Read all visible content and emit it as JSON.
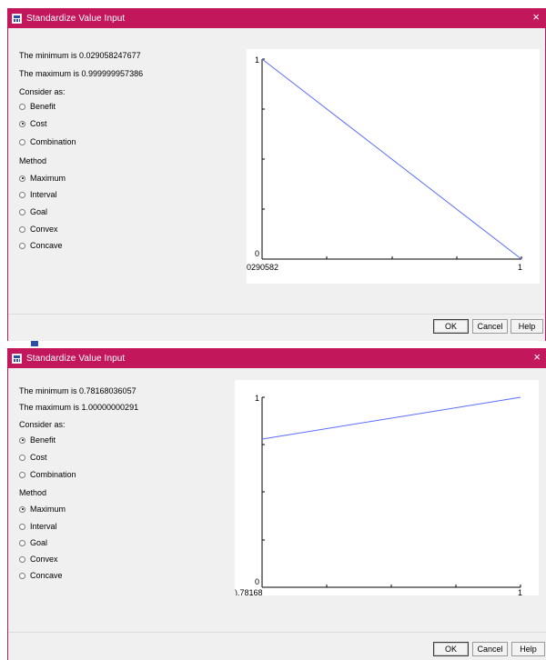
{
  "dialogs": [
    {
      "title": "Standardize Value Input",
      "close": "×",
      "min_text": "The minimum is 0.029058247677",
      "max_text": "The maximum is 0.999999957386",
      "consider_label": "Consider as:",
      "consider_options": [
        {
          "label": "Benefit",
          "selected": false
        },
        {
          "label": "Cost",
          "selected": true
        },
        {
          "label": "Combination",
          "selected": false
        }
      ],
      "method_label": "Method",
      "method_options": [
        {
          "label": "Maximum",
          "selected": true
        },
        {
          "label": "Interval",
          "selected": false
        },
        {
          "label": "Goal",
          "selected": false
        },
        {
          "label": "Convex",
          "selected": false
        },
        {
          "label": "Concave",
          "selected": false
        }
      ],
      "chart": {
        "y_top_label": "1",
        "y_bottom_label": "0",
        "x_left_label": "0290582",
        "x_right_label": "1"
      },
      "buttons": {
        "ok": "OK",
        "cancel": "Cancel",
        "help": "Help"
      }
    },
    {
      "title": "Standardize Value Input",
      "close": "×",
      "min_text": "The minimum is 0.78168036057",
      "max_text": "The maximum is 1.00000000291",
      "consider_label": "Consider as:",
      "consider_options": [
        {
          "label": "Benefit",
          "selected": true
        },
        {
          "label": "Cost",
          "selected": false
        },
        {
          "label": "Combination",
          "selected": false
        }
      ],
      "method_label": "Method",
      "method_options": [
        {
          "label": "Maximum",
          "selected": true
        },
        {
          "label": "Interval",
          "selected": false
        },
        {
          "label": "Goal",
          "selected": false
        },
        {
          "label": "Convex",
          "selected": false
        },
        {
          "label": "Concave",
          "selected": false
        }
      ],
      "chart": {
        "y_top_label": "1",
        "y_bottom_label": "0",
        "x_left_label": ").78168",
        "x_right_label": "1"
      },
      "buttons": {
        "ok": "OK",
        "cancel": "Cancel",
        "help": "Help"
      }
    }
  ],
  "chart_data": [
    {
      "type": "line",
      "x": [
        0.029058247677,
        1
      ],
      "series": [
        {
          "values": [
            1,
            0
          ]
        }
      ],
      "xlim": [
        0.029058247677,
        1
      ],
      "ylim": [
        0,
        1
      ],
      "line_color": "#5a6cff"
    },
    {
      "type": "line",
      "x": [
        0.78168036057,
        1
      ],
      "series": [
        {
          "values": [
            0.78,
            1
          ]
        }
      ],
      "xlim": [
        0.78168036057,
        1
      ],
      "ylim": [
        0,
        1
      ],
      "line_color": "#5a6cff"
    }
  ],
  "colors": {
    "titlebar": "#c2185b",
    "dialog_bg": "#f0f0f0"
  }
}
